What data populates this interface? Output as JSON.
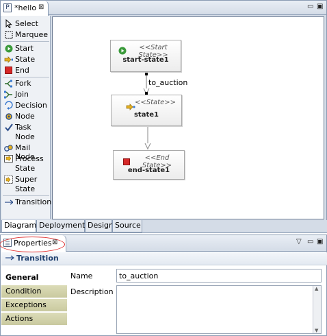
{
  "editor": {
    "tab": {
      "icon_letter": "P",
      "title": "*hello"
    },
    "palette": {
      "tools": [
        {
          "label": "Select",
          "icon": "cursor-icon"
        },
        {
          "label": "Marquee",
          "icon": "marquee-icon"
        }
      ],
      "nodes_a": [
        {
          "label": "Start",
          "icon": "start-icon"
        },
        {
          "label": "State",
          "icon": "state-icon"
        },
        {
          "label": "End",
          "icon": "end-icon"
        }
      ],
      "nodes_b": [
        {
          "label": "Fork",
          "icon": "fork-icon"
        },
        {
          "label": "Join",
          "icon": "join-icon"
        },
        {
          "label": "Decision",
          "icon": "decision-icon"
        },
        {
          "label": "Node",
          "icon": "node-icon"
        },
        {
          "label_1": "Task",
          "label_2": "Node",
          "icon": "task-node-icon"
        },
        {
          "label": "Mail Node",
          "icon": "mail-node-icon"
        },
        {
          "label_1": "Process",
          "label_2": "State",
          "icon": "process-state-icon"
        },
        {
          "label_1": "Super",
          "label_2": "State",
          "icon": "super-state-icon"
        }
      ],
      "connections": [
        {
          "label": "Transition",
          "icon": "transition-arrow-icon"
        }
      ]
    },
    "diagram": {
      "start_state": {
        "stereotype": "<<Start State>>",
        "name": "start-state1"
      },
      "state": {
        "stereotype": "<<State>>",
        "name": "state1"
      },
      "end_state": {
        "stereotype": "<<End State>>",
        "name": "end-state1"
      },
      "transition_label": "to_auction"
    },
    "bottom_tabs": [
      "Diagram",
      "Deployment",
      "Design",
      "Source"
    ],
    "active_bottom_tab": "Diagram"
  },
  "properties": {
    "tab_title": "Properties",
    "section_title": "Transition",
    "side_tabs": [
      "General",
      "Condition",
      "Exceptions",
      "Actions"
    ],
    "active_side_tab": "General",
    "fields": {
      "name_label": "Name",
      "name_value": "to_auction",
      "description_label": "Description",
      "description_value": ""
    }
  },
  "colors": {
    "start_green": "#3a9a3a",
    "end_red": "#d62828",
    "state_yellow": "#e5b020",
    "section_title_blue": "#1f3f6e",
    "highlight_red": "#e03030"
  }
}
